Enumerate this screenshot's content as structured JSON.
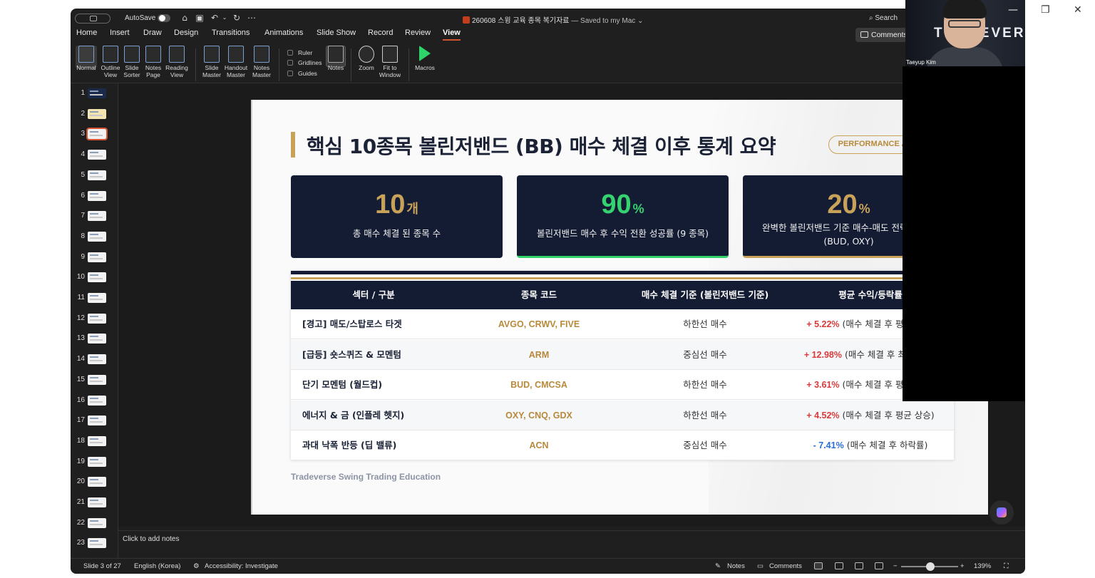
{
  "titlebar": {
    "autosave_label": "AutoSave",
    "doc_title": "260608 스윙 교육 종목 복기자료",
    "saved_status": "— Saved to my Mac",
    "search_label": "Search"
  },
  "window_controls": {
    "minimize": "—",
    "restore": "❐",
    "close": "✕"
  },
  "menu": {
    "items": [
      "Home",
      "Insert",
      "Draw",
      "Design",
      "Transitions",
      "Animations",
      "Slide Show",
      "Record",
      "Review",
      "View"
    ],
    "active": "View",
    "comments_label": "Comments"
  },
  "ribbon": {
    "normal": "Normal",
    "outline": "Outline View",
    "sorter": "Slide Sorter",
    "notes_page": "Notes Page",
    "reading": "Reading View",
    "slide_master": "Slide Master",
    "handout_master": "Handout Master",
    "notes_master": "Notes Master",
    "ruler": "Ruler",
    "gridlines": "Gridlines",
    "guides": "Guides",
    "notes": "Notes",
    "zoom": "Zoom",
    "fit": "Fit to Window",
    "macros": "Macros"
  },
  "thumbnails": [
    "1",
    "2",
    "3",
    "4",
    "5",
    "6",
    "7",
    "8",
    "9",
    "10",
    "11",
    "12",
    "13",
    "14",
    "15",
    "16",
    "17",
    "18",
    "19",
    "20",
    "21",
    "22",
    "23"
  ],
  "selected_slide": 3,
  "slide": {
    "title": "핵심 10종목 볼린저밴드 (BB) 매수 체결 이후 통계 요약",
    "badge": "PERFORMANCE ANALYTICS",
    "kpis": [
      {
        "value": "10",
        "unit": "개",
        "label": "총 매수 체결 된 종목 수",
        "color": "#c9a25a"
      },
      {
        "value": "90",
        "unit": "%",
        "label": "볼린저밴드 매수 후 수익 전환 성공률 (9 종목)",
        "color": "#35d36f"
      },
      {
        "value": "20",
        "unit": "%",
        "label": "완벽한 볼린저밴드 기준 매수-매도 전략 성공률 (BUD, OXY)",
        "color": "#c9a25a"
      }
    ],
    "table": {
      "headers": [
        "섹터 / 구분",
        "종목 코드",
        "매수 체결 기준 (볼린저밴드 기준)",
        "평균 수익/등락률"
      ],
      "rows": [
        {
          "sector": "[경고] 매도/스탑로스 타겟",
          "code": "AVGO, CRWV, FIVE",
          "basis": "하한선 매수",
          "ret": "+ 5.22%",
          "note": "(매수 체결 후 평균 상승)"
        },
        {
          "sector": "[급등] 숏스퀴즈 & 모멘텀",
          "code": "ARM",
          "basis": "중심선 매수",
          "ret": "+ 12.98%",
          "note": "(매수 체결 후 최고 상승)"
        },
        {
          "sector": "단기 모멘텀 (월드컵)",
          "code": "BUD, CMCSA",
          "basis": "하한선 매수",
          "ret": "+ 3.61%",
          "note": "(매수 체결 후 평균 상승)"
        },
        {
          "sector": "에너지 & 금 (인플레 헷지)",
          "code": "OXY, CNQ, GDX",
          "basis": "하한선 매수",
          "ret": "+ 4.52%",
          "note": "(매수 체결 후 평균 상승)"
        },
        {
          "sector": "과대 낙폭 반등 (딥 밸류)",
          "code": "ACN",
          "basis": "중심선 매수",
          "ret": "- 7.41%",
          "note": "(매수 체결 후 하락률)"
        }
      ]
    },
    "footer": "Tradeverse Swing Trading Education"
  },
  "notes_placeholder": "Click to add notes",
  "status": {
    "slide_count": "Slide 3 of 27",
    "language": "English (Korea)",
    "accessibility": "Accessibility: Investigate",
    "notes": "Notes",
    "comments": "Comments",
    "zoom": "139%",
    "zoom_minus": "−",
    "zoom_plus": "+"
  },
  "webcam": {
    "name": "Taeyup Kim",
    "logo_text": "TRADEVERS"
  }
}
